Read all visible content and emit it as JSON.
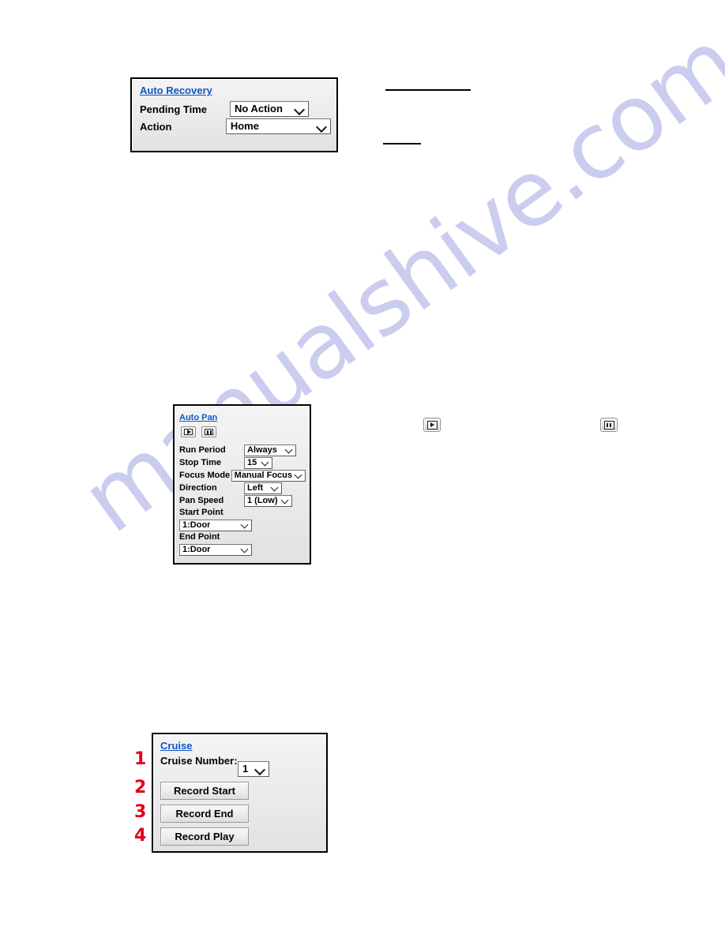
{
  "watermark": {
    "text": "manualshive.com",
    "color": "#c9cbef"
  },
  "callouts": {
    "one": "1",
    "two": "2",
    "three": "3",
    "four": "4",
    "color": "#e2001a"
  },
  "auto_recovery": {
    "title": "Auto Recovery",
    "title_color": "#1156c6",
    "rows": [
      {
        "label": "Pending Time",
        "value": "No Action"
      },
      {
        "label": "Action",
        "value": "Home"
      }
    ]
  },
  "auto_pan": {
    "title": "Auto Pan",
    "title_color": "#1156c6",
    "buttons": [
      {
        "name": "play",
        "icon": "play-icon"
      },
      {
        "name": "pause",
        "icon": "pause-icon"
      }
    ],
    "rows": [
      {
        "label": "Run Period",
        "value": "Always"
      },
      {
        "label": "Stop Time",
        "value": "15"
      },
      {
        "label": "Focus Mode",
        "value": "Manual Focus"
      },
      {
        "label": "Direction",
        "value": "Left"
      },
      {
        "label": "Pan Speed",
        "value": "1 (Low)"
      }
    ],
    "start_point": {
      "label": "Start Point",
      "value": "1:Door"
    },
    "end_point": {
      "label": "End Point",
      "value": "1:Door"
    }
  },
  "cruise": {
    "title": "Cruise",
    "title_color": "#1156c6",
    "number_label": "Cruise Number:",
    "number_value": "1",
    "buttons": [
      {
        "label": "Record Start"
      },
      {
        "label": "Record End"
      },
      {
        "label": "Record Play"
      }
    ]
  },
  "inline_icons": [
    {
      "name": "play-icon"
    },
    {
      "name": "pause-icon"
    }
  ]
}
